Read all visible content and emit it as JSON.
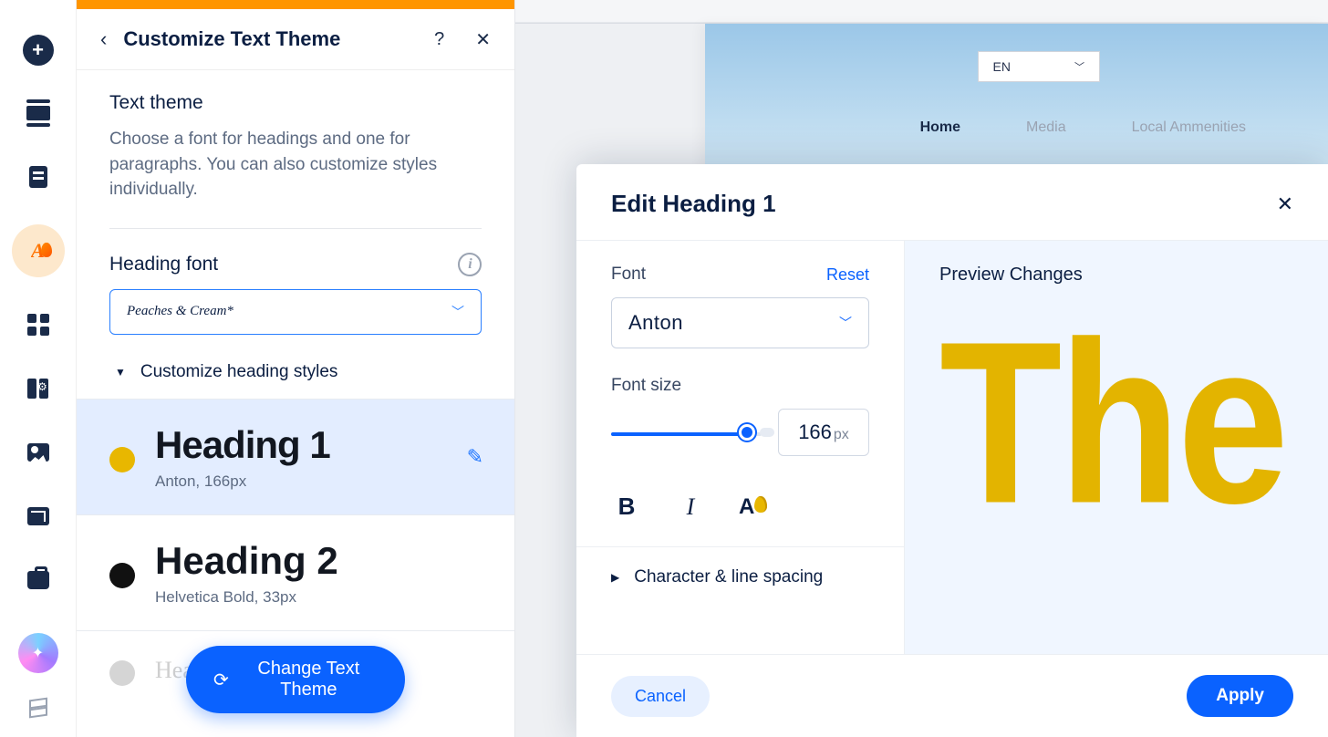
{
  "rail": {
    "add_tooltip": "+",
    "sparkle_tooltip": "✦"
  },
  "sidebar": {
    "title": "Customize Text Theme",
    "section_title": "Text theme",
    "section_desc": "Choose a font for headings and one for paragraphs. You can also customize styles individually.",
    "heading_font_label": "Heading font",
    "heading_font_value": "Peaches & Cream*",
    "accordion_label": "Customize heading styles",
    "items": [
      {
        "title": "Heading 1",
        "meta": "Anton, 166px"
      },
      {
        "title": "Heading 2",
        "meta": "Helvetica Bold, 33px"
      },
      {
        "title": "Heading 3",
        "meta": ""
      }
    ],
    "change_btn": "Change Text Theme"
  },
  "canvas": {
    "lang": "EN",
    "nav": [
      "Home",
      "Media",
      "Local Ammenities"
    ]
  },
  "modal": {
    "title": "Edit Heading 1",
    "font_label": "Font",
    "reset": "Reset",
    "font_value": "Anton",
    "size_label": "Font size",
    "size_value": "166",
    "size_unit": "px",
    "char_label": "Character & line spacing",
    "preview_label": "Preview Changes",
    "preview_text": "The",
    "cancel": "Cancel",
    "apply": "Apply"
  }
}
